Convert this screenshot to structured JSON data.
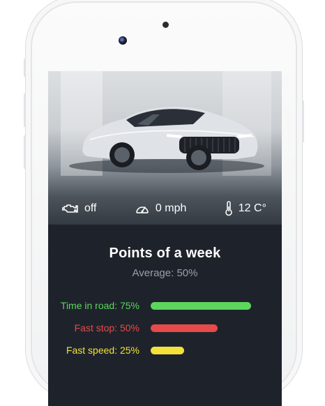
{
  "status": {
    "engine": {
      "icon": "engine-icon",
      "value": "off"
    },
    "speed": {
      "icon": "speedometer-icon",
      "value": "0 mph"
    },
    "temperature": {
      "icon": "thermometer-icon",
      "value": "12 C°"
    }
  },
  "points": {
    "title": "Points of a week",
    "average": "Average: 50%",
    "metrics": [
      {
        "label": "Time in road: 75%",
        "percent": 75,
        "color": "#5cd65c"
      },
      {
        "label": "Fast stop: 50%",
        "percent": 50,
        "color": "#e64a4a"
      },
      {
        "label": "Fast speed: 25%",
        "percent": 25,
        "color": "#f2e23a"
      }
    ]
  },
  "colors": {
    "screen_bg": "#1e232b",
    "title": "#ffffff",
    "subtitle": "#9aa0a8"
  }
}
